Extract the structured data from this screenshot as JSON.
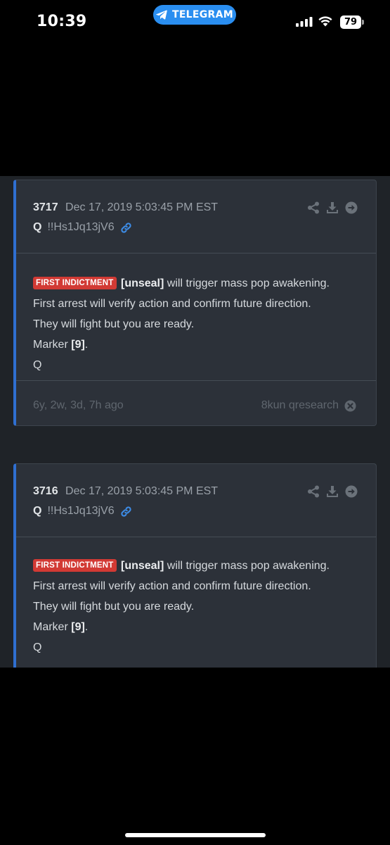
{
  "status_bar": {
    "time": "10:39",
    "app_pill": "TELEGRAM",
    "battery": "79"
  },
  "colors": {
    "accent": "#2f6fd1",
    "badge": "#d23a34",
    "pill": "#2a8ef0",
    "card_bg": "#2c3139"
  },
  "posts": [
    {
      "number": "3717",
      "date": "Dec 17, 2019 5:03:45 PM EST",
      "author": "Q",
      "tripcode": "!!Hs1Jq13jV6",
      "badge": "FIRST INDICTMENT",
      "bold_text": "[unseal]",
      "line1_rest": " will trigger mass pop awakening.",
      "line2": "First arrest will verify action and confirm future direction.",
      "line3": "They will fight but you are ready.",
      "marker_prefix": "Marker ",
      "marker_value": "[9]",
      "marker_suffix": ".",
      "signature": "Q",
      "age": "6y, 2w, 3d, 7h ago",
      "source": "8kun qresearch"
    },
    {
      "number": "3716",
      "date": "Dec 17, 2019 5:03:45 PM EST",
      "author": "Q",
      "tripcode": "!!Hs1Jq13jV6",
      "badge": "FIRST INDICTMENT",
      "bold_text": "[unseal]",
      "line1_rest": " will trigger mass pop awakening.",
      "line2": "First arrest will verify action and confirm future direction.",
      "line3": "They will fight but you are ready.",
      "marker_prefix": "Marker ",
      "marker_value": "[9]",
      "marker_suffix": ".",
      "signature": "Q"
    }
  ],
  "icons": [
    "telegram-icon",
    "signal-icon",
    "wifi-icon",
    "battery-icon",
    "share-icon",
    "download-icon",
    "arrow-right-circle-icon",
    "link-icon",
    "close-circle-icon"
  ]
}
